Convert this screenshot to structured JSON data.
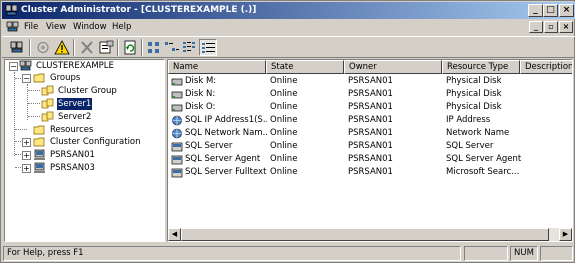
{
  "window": {
    "title": "Cluster Administrator - [CLUSTEREXAMPLE (.)]"
  },
  "caption_buttons": {
    "minimize": "_",
    "maximize": "□",
    "close": "×"
  },
  "menu": {
    "items": [
      "File",
      "View",
      "Window",
      "Help"
    ]
  },
  "mdi_buttons": {
    "minimize": "_",
    "restore": "▫",
    "close": "×"
  },
  "toolbar": {
    "buttons": [
      "cluster-connect-icon",
      "bring-online-icon",
      "warning-icon",
      "delete-icon",
      "properties-icon",
      "refresh-icon",
      "large-icons-view-icon",
      "small-icons-view-icon",
      "list-view-icon",
      "details-view-icon"
    ]
  },
  "tree": {
    "root": "CLUSTEREXAMPLE",
    "groups": "Groups",
    "cluster_group": "Cluster Group",
    "server1": "Server1",
    "server2": "Server2",
    "resources": "Resources",
    "cluster_configuration": "Cluster Configuration",
    "node1": "PSRSAN01",
    "node3": "PSRSAN03"
  },
  "list": {
    "columns": [
      "Name",
      "State",
      "Owner",
      "Resource Type",
      "Description"
    ],
    "rows": [
      {
        "name": "Disk M:",
        "state": "Online",
        "owner": "PSRSAN01",
        "type": "Physical Disk",
        "icon": "disk-icon"
      },
      {
        "name": "Disk N:",
        "state": "Online",
        "owner": "PSRSAN01",
        "type": "Physical Disk",
        "icon": "disk-icon"
      },
      {
        "name": "Disk O:",
        "state": "Online",
        "owner": "PSRSAN01",
        "type": "Physical Disk",
        "icon": "disk-icon"
      },
      {
        "name": "SQL IP Address1(S...",
        "state": "Online",
        "owner": "PSRSAN01",
        "type": "IP Address",
        "icon": "network-icon"
      },
      {
        "name": "SQL Network Nam...",
        "state": "Online",
        "owner": "PSRSAN01",
        "type": "Network Name",
        "icon": "network-icon"
      },
      {
        "name": "SQL Server",
        "state": "Online",
        "owner": "PSRSAN01",
        "type": "SQL Server",
        "icon": "resource-icon"
      },
      {
        "name": "SQL Server Agent",
        "state": "Online",
        "owner": "PSRSAN01",
        "type": "SQL Server Agent",
        "icon": "resource-icon"
      },
      {
        "name": "SQL Server Fulltext",
        "state": "Online",
        "owner": "PSRSAN01",
        "type": "Microsoft Searc...",
        "icon": "resource-icon"
      }
    ]
  },
  "scrollbar": {
    "left_arrow": "◀",
    "right_arrow": "▶"
  },
  "status": {
    "text": "For Help, press F1",
    "num": "NUM"
  }
}
